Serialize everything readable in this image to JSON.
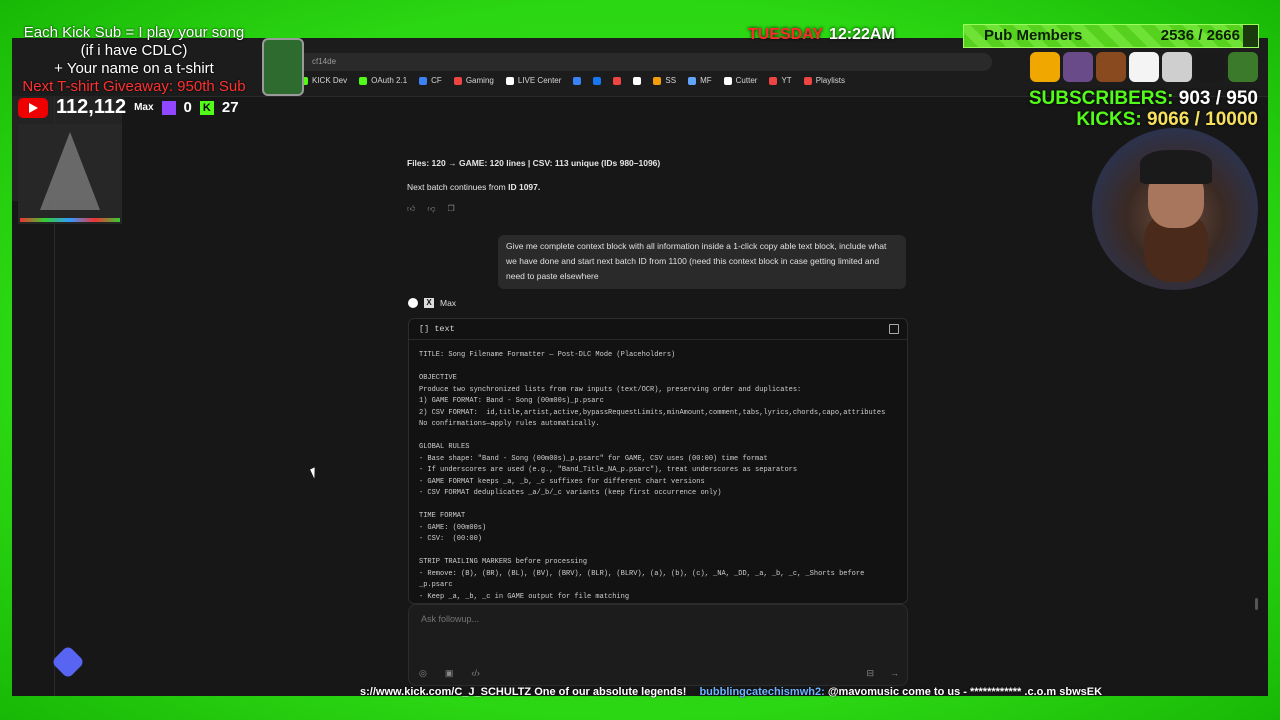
{
  "overlay": {
    "kick_sub_line1": "Each Kick Sub = I play your song",
    "kick_sub_line2": "(if i have CDLC)",
    "name_line": "+ Your name on a t-shirt",
    "giveaway_line": "Next T-shirt Giveaway: 950th Sub",
    "youtube_count": "112,112",
    "x_label": "Max",
    "twitch_count": "0",
    "kick_count": "27",
    "day": "TUESDAY",
    "time": "12:22AM",
    "pub_label": "Pub Members",
    "pub_count": "2536 / 2666",
    "pub_progress": 0.95,
    "subscribers_label": "SUBSCRIBERS:",
    "subscribers_value": "903 / 950",
    "kicks_label": "KICKS:",
    "kicks_value": "9066 / 10000",
    "ticker_text": "s://www.kick.com/C_J_SCHULTZ One of our absolute legends!",
    "ticker_user": "bubblingcatechismwh2:",
    "ticker_msg": "@mavomusic come to us - ************ .c.o.m sbwsEK"
  },
  "browser": {
    "url": "cf14de",
    "bookmarks": [
      {
        "label": "KICK Dev",
        "color": "#53fc18"
      },
      {
        "label": "OAuth 2.1",
        "color": "#53fc18"
      },
      {
        "label": "CF",
        "color": "#3b82f6"
      },
      {
        "label": "Gaming",
        "color": "#ef4444"
      },
      {
        "label": "LIVE Center",
        "color": "#ffffff"
      },
      {
        "label": "",
        "color": "#3b82f6"
      },
      {
        "label": "",
        "color": "#1877f2"
      },
      {
        "label": "",
        "color": "#ef4444"
      },
      {
        "label": "",
        "color": "#ffffff"
      },
      {
        "label": "SS",
        "color": "#f59e0b"
      },
      {
        "label": "MF",
        "color": "#60a5fa"
      },
      {
        "label": "Cutter",
        "color": "#ffffff"
      },
      {
        "label": "YT",
        "color": "#ef4444"
      },
      {
        "label": "Playlists",
        "color": "#ef4444"
      }
    ]
  },
  "chat": {
    "files_line": "Files: 120 → GAME: 120 lines | CSV: 113 unique (IDs 980–1096)",
    "next_batch_prefix": "Next batch continues from ",
    "next_batch_id": "ID 1097.",
    "user_message": "Give me complete context block with all information inside a 1-click copy able text block, include what we have done and start next batch ID from 1100 (need this context block in case getting limited and need to paste elsewhere",
    "assistant_name": "Max",
    "code_lang": "text",
    "code_content": "TITLE: Song Filename Formatter — Post-DLC Mode (Placeholders)\n\nOBJECTIVE\nProduce two synchronized lists from raw inputs (text/OCR), preserving order and duplicates:\n1) GAME FORMAT: Band - Song (00m00s)_p.psarc\n2) CSV FORMAT:  id,title,artist,active,bypassRequestLimits,minAmount,comment,tabs,lyrics,chords,capo,attributes\nNo confirmations—apply rules automatically.\n\nGLOBAL RULES\n- Base shape: \"Band - Song (00m00s)_p.psarc\" for GAME, CSV uses (00:00) time format\n- If underscores are used (e.g., \"Band_Title_NA_p.psarc\"), treat underscores as separators\n- GAME FORMAT keeps _a, _b, _c suffixes for different chart versions\n- CSV FORMAT deduplicates _a/_b/_c variants (keep first occurrence only)\n\nTIME FORMAT\n- GAME: (00m00s)\n- CSV:  (00:00)\n\nSTRIP TRAILING MARKERS before processing\n- Remove: (B), (BR), (BL), (BV), (BRV), (BLR), (BLRV), (a), (b), (c), _NA, _DD, _a, _b, _c, _Shorts before\n_p.psarc\n- Keep _a, _b, _c in GAME output for file matching",
    "input_placeholder": "Ask followup..."
  }
}
